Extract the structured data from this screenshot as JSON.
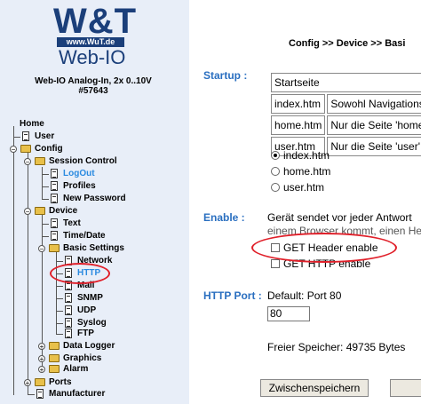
{
  "logo": {
    "brand": "W&T",
    "url_bar": "www.WuT.de",
    "product": "Web-IO"
  },
  "device": {
    "name": "Web-IO Analog-In, 2x 0..10V",
    "number": "#57643"
  },
  "tree": {
    "home": "Home",
    "user": "User",
    "config": "Config",
    "session_control": "Session Control",
    "logout": "LogOut",
    "profiles": "Profiles",
    "new_password": "New Password",
    "device": "Device",
    "text": "Text",
    "time_date": "Time/Date",
    "basic_settings": "Basic Settings",
    "network": "Network",
    "http": "HTTP",
    "mail": "Mail",
    "snmp": "SNMP",
    "udp": "UDP",
    "syslog": "Syslog",
    "ftp": "FTP",
    "data_logger": "Data Logger",
    "graphics": "Graphics",
    "alarm": "Alarm",
    "ports": "Ports",
    "manufacturer": "Manufacturer"
  },
  "main": {
    "breadcrumb": "Config >> Device >> Basi",
    "startup": {
      "label": "Startup :",
      "rows": [
        [
          "Startseite",
          ""
        ],
        [
          "index.htm",
          "Sowohl Navigations"
        ],
        [
          "home.htm",
          "Nur die Seite 'home"
        ],
        [
          "user.htm",
          "Nur die Seite 'user'"
        ]
      ],
      "options": [
        "index.htm",
        "home.htm",
        "user.htm"
      ],
      "selected": "index.htm"
    },
    "enable": {
      "label": "Enable :",
      "desc_line1": "Gerät sendet vor jeder Antwort",
      "desc_line2": "einem Browser kommt, einen He",
      "get_header": "GET Header enable",
      "get_http": "GET HTTP enable"
    },
    "http_port": {
      "label": "HTTP Port :",
      "default": "Default: Port 80",
      "value": "80"
    },
    "free_memory": "Freier Speicher: 49735 Bytes",
    "save_button": "Zwischenspeichern"
  },
  "colors": {
    "sidebar_bg": "#e8eef8",
    "brand": "#1b3f7a",
    "section_label": "#2a6fc0",
    "link_active": "#2a8ae0",
    "highlight": "#e0202a"
  }
}
